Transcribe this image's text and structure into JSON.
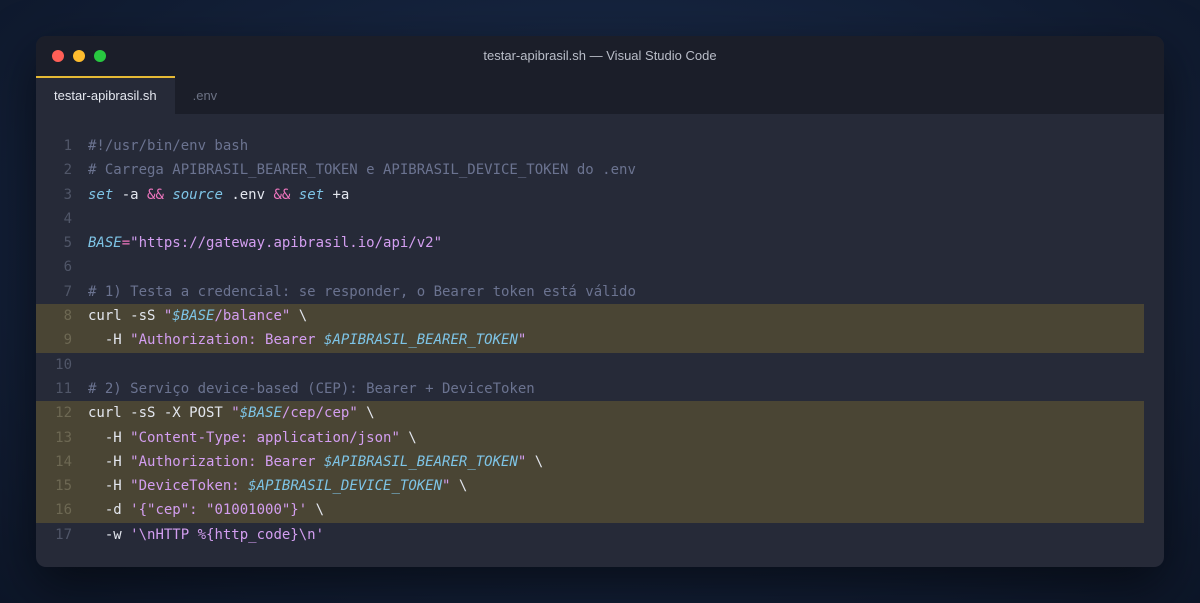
{
  "window": {
    "title": "testar-apibrasil.sh — Visual Studio Code"
  },
  "tabs": [
    {
      "label": "testar-apibrasil.sh",
      "active": true
    },
    {
      "label": ".env",
      "active": false
    }
  ],
  "colors": {
    "highlight": "#4a4534",
    "tab_accent": "#e5b935",
    "comment": "#6b7390",
    "keyword": "#7ec4e6",
    "operator": "#f076c0",
    "string": "#d39ef0"
  },
  "editor": {
    "lines": [
      {
        "n": "1",
        "hl": false,
        "tokens": [
          {
            "t": "#!/usr/bin/env bash",
            "c": "c"
          }
        ]
      },
      {
        "n": "2",
        "hl": false,
        "tokens": [
          {
            "t": "# Carrega APIBRASIL_BEARER_TOKEN e APIBRASIL_DEVICE_TOKEN do .env",
            "c": "c"
          }
        ]
      },
      {
        "n": "3",
        "hl": false,
        "tokens": [
          {
            "t": "set",
            "c": "k"
          },
          {
            "t": " -a ",
            "c": "t"
          },
          {
            "t": "&&",
            "c": "o"
          },
          {
            "t": " ",
            "c": "t"
          },
          {
            "t": "source",
            "c": "k"
          },
          {
            "t": " .env ",
            "c": "t"
          },
          {
            "t": "&&",
            "c": "o"
          },
          {
            "t": " ",
            "c": "t"
          },
          {
            "t": "set",
            "c": "k"
          },
          {
            "t": " +a",
            "c": "t"
          }
        ]
      },
      {
        "n": "4",
        "hl": false,
        "tokens": []
      },
      {
        "n": "5",
        "hl": false,
        "tokens": [
          {
            "t": "BASE",
            "c": "v"
          },
          {
            "t": "=",
            "c": "o"
          },
          {
            "t": "\"https://gateway.apibrasil.io/api/v2\"",
            "c": "s"
          }
        ]
      },
      {
        "n": "6",
        "hl": false,
        "tokens": []
      },
      {
        "n": "7",
        "hl": false,
        "tokens": [
          {
            "t": "# 1) Testa a credencial: se responder, o Bearer token está válido",
            "c": "c"
          }
        ]
      },
      {
        "n": "8",
        "hl": true,
        "tokens": [
          {
            "t": "curl -sS ",
            "c": "t"
          },
          {
            "t": "\"",
            "c": "s"
          },
          {
            "t": "$BASE",
            "c": "v"
          },
          {
            "t": "/balance\"",
            "c": "s"
          },
          {
            "t": " \\",
            "c": "t"
          }
        ]
      },
      {
        "n": "9",
        "hl": true,
        "tokens": [
          {
            "t": "  -H ",
            "c": "t"
          },
          {
            "t": "\"Authorization: Bearer ",
            "c": "s"
          },
          {
            "t": "$APIBRASIL_BEARER_TOKEN",
            "c": "v"
          },
          {
            "t": "\"",
            "c": "s"
          }
        ]
      },
      {
        "n": "10",
        "hl": false,
        "tokens": []
      },
      {
        "n": "11",
        "hl": false,
        "tokens": [
          {
            "t": "# 2) Serviço device-based (CEP): Bearer + DeviceToken",
            "c": "c"
          }
        ]
      },
      {
        "n": "12",
        "hl": true,
        "tokens": [
          {
            "t": "curl -sS -X POST ",
            "c": "t"
          },
          {
            "t": "\"",
            "c": "s"
          },
          {
            "t": "$BASE",
            "c": "v"
          },
          {
            "t": "/cep/cep\"",
            "c": "s"
          },
          {
            "t": " \\",
            "c": "t"
          }
        ]
      },
      {
        "n": "13",
        "hl": true,
        "tokens": [
          {
            "t": "  -H ",
            "c": "t"
          },
          {
            "t": "\"Content-Type: application/json\"",
            "c": "s"
          },
          {
            "t": " \\",
            "c": "t"
          }
        ]
      },
      {
        "n": "14",
        "hl": true,
        "tokens": [
          {
            "t": "  -H ",
            "c": "t"
          },
          {
            "t": "\"Authorization: Bearer ",
            "c": "s"
          },
          {
            "t": "$APIBRASIL_BEARER_TOKEN",
            "c": "v"
          },
          {
            "t": "\"",
            "c": "s"
          },
          {
            "t": " \\",
            "c": "t"
          }
        ]
      },
      {
        "n": "15",
        "hl": true,
        "tokens": [
          {
            "t": "  -H ",
            "c": "t"
          },
          {
            "t": "\"DeviceToken: ",
            "c": "s"
          },
          {
            "t": "$APIBRASIL_DEVICE_TOKEN",
            "c": "v"
          },
          {
            "t": "\"",
            "c": "s"
          },
          {
            "t": " \\",
            "c": "t"
          }
        ]
      },
      {
        "n": "16",
        "hl": true,
        "tokens": [
          {
            "t": "  -d ",
            "c": "t"
          },
          {
            "t": "'{\"cep\": \"01001000\"}'",
            "c": "s"
          },
          {
            "t": " \\",
            "c": "t"
          }
        ]
      },
      {
        "n": "17",
        "hl": false,
        "tokens": [
          {
            "t": "  -w ",
            "c": "t"
          },
          {
            "t": "'\\nHTTP %{http_code}\\n'",
            "c": "s"
          }
        ]
      }
    ]
  }
}
